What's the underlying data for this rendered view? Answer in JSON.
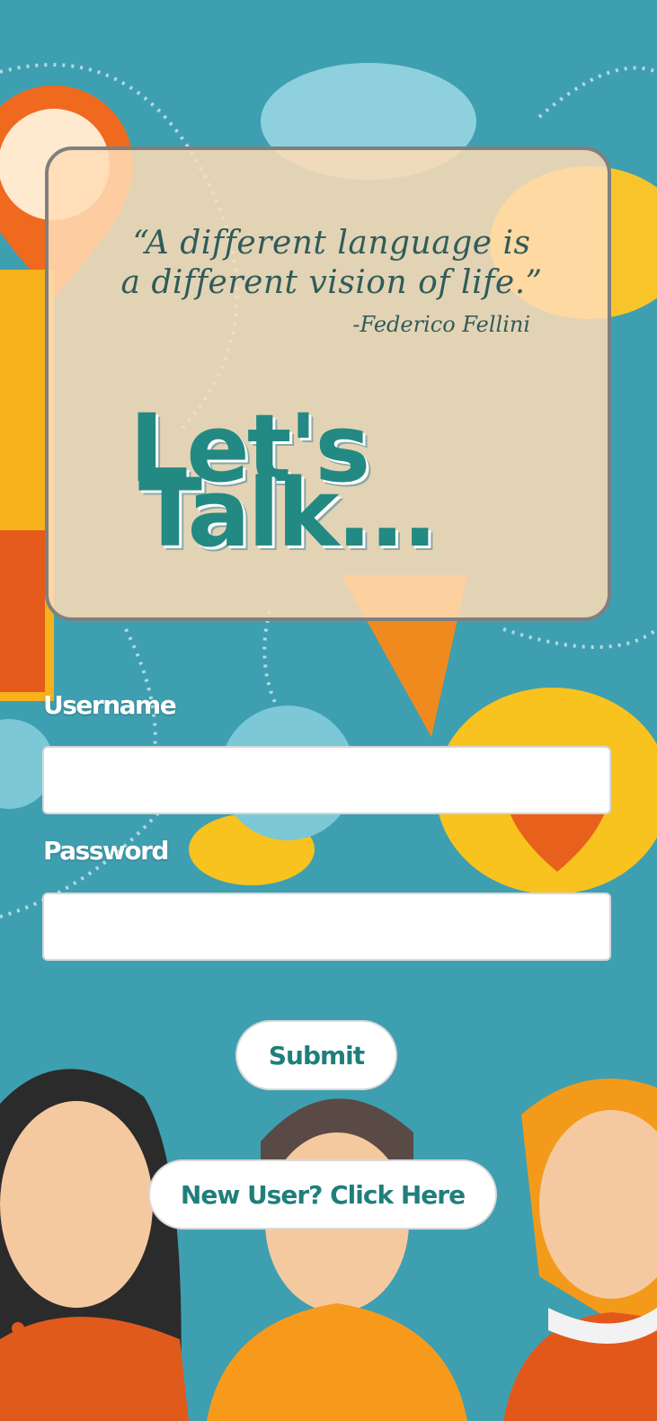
{
  "quote": {
    "text": "“A different language is a different vision of life.”",
    "author": "-Federico Fellini"
  },
  "hero": {
    "line1": "Let's",
    "line2": "Talk..."
  },
  "form": {
    "username_label": "Username",
    "username_value": "",
    "password_label": "Password",
    "password_value": ""
  },
  "buttons": {
    "submit": "Submit",
    "new_user": "New User? Click Here"
  },
  "colors": {
    "background": "#3e9fb1",
    "accent_teal": "#238983",
    "card": "#ffdcb6"
  }
}
